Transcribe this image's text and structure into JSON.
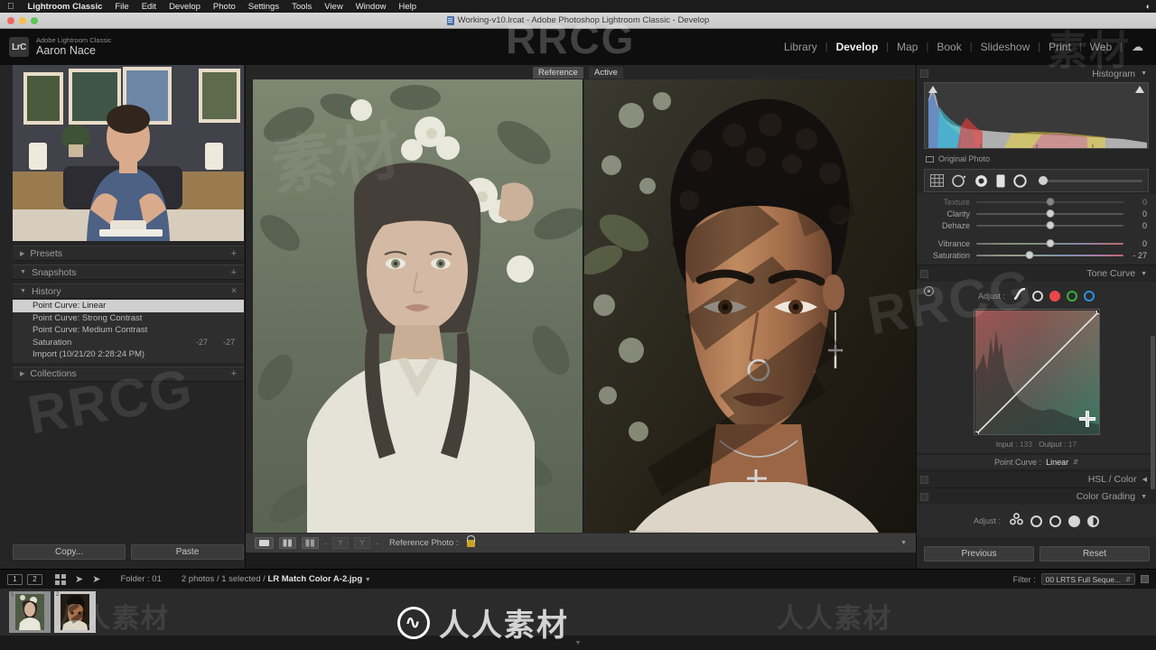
{
  "macmenu": {
    "apple_icon": "apple-icon",
    "items": [
      "Lightroom Classic",
      "File",
      "Edit",
      "Develop",
      "Photo",
      "Settings",
      "Tools",
      "View",
      "Window",
      "Help"
    ],
    "right_icons": [
      "siri-icon"
    ]
  },
  "window": {
    "title": "Working-v10.lrcat - Adobe Photoshop Lightroom Classic - Develop",
    "doc_icon": "catalog-file-icon",
    "traffic_lights": [
      "close",
      "minimize",
      "zoom"
    ]
  },
  "identity": {
    "logo": "LrC",
    "product": "Adobe Lightroom Classic",
    "user": "Aaron Nace"
  },
  "modules": {
    "items": [
      {
        "label": "Library",
        "active": false
      },
      {
        "label": "Develop",
        "active": true
      },
      {
        "label": "Map",
        "active": false
      },
      {
        "label": "Book",
        "active": false
      },
      {
        "label": "Slideshow",
        "active": false
      },
      {
        "label": "Print",
        "active": false
      },
      {
        "label": "Web",
        "active": false
      }
    ],
    "separator": "|",
    "cloud_icon": "cloud-icon"
  },
  "left_panel": {
    "navigator_alt": "video instructor preview",
    "sections": [
      {
        "name": "presets",
        "label": "Presets",
        "expanded": false,
        "action": "+"
      },
      {
        "name": "snapshots",
        "label": "Snapshots",
        "expanded": true,
        "action": "+"
      },
      {
        "name": "history",
        "label": "History",
        "expanded": true,
        "action": "×"
      },
      {
        "name": "collections",
        "label": "Collections",
        "expanded": false,
        "action": "+"
      }
    ],
    "history": [
      {
        "label": "Point Curve: Linear",
        "v1": "",
        "v2": "",
        "selected": true
      },
      {
        "label": "Point Curve: Strong Contrast",
        "v1": "",
        "v2": "",
        "selected": false
      },
      {
        "label": "Point Curve: Medium Contrast",
        "v1": "",
        "v2": "",
        "selected": false
      },
      {
        "label": "Saturation",
        "v1": "-27",
        "v2": "-27",
        "selected": false
      },
      {
        "label": "Import (10/21/20 2:28:24 PM)",
        "v1": "",
        "v2": "",
        "selected": false
      }
    ],
    "copy_label": "Copy...",
    "paste_label": "Paste"
  },
  "center": {
    "reference_label": "Reference",
    "active_label": "Active",
    "toolbar": {
      "loupe_icon": "loupe-view-icon",
      "compare_icon": "reference-compare-icon",
      "split_icon": "reference-split-icon",
      "dash1": "-",
      "before_icon": "before-view-icon",
      "after_icon": "after-view-icon",
      "dash2": "-",
      "reference_photo_label": "Reference Photo :",
      "lock_icon": "lock-icon",
      "chevron_icon": "chevron-down-icon"
    }
  },
  "right_panel": {
    "histogram": {
      "title": "Histogram",
      "collapse_icon": "chevron-down-icon",
      "shadow_clip_icon": "shadow-clipping-icon",
      "highlight_clip_icon": "highlight-clipping-icon",
      "original_photo_label": "Original Photo"
    },
    "tools": [
      "crop-tool-icon",
      "spot-removal-icon",
      "red-eye-icon",
      "graduated-filter-icon",
      "radial-filter-icon",
      "adjustment-brush-icon"
    ],
    "basic_sliders": [
      {
        "label": "Texture",
        "value": "0",
        "pos": 50,
        "style": "plain",
        "clipped": true
      },
      {
        "label": "Clarity",
        "value": "0",
        "pos": 50,
        "style": "plain",
        "clipped": false
      },
      {
        "label": "Dehaze",
        "value": "0",
        "pos": 50,
        "style": "plain",
        "clipped": false
      },
      {
        "label": "Vibrance",
        "value": "0",
        "pos": 50,
        "style": "vib",
        "clipped": false
      },
      {
        "label": "Saturation",
        "value": "- 27",
        "pos": 36,
        "style": "sat",
        "clipped": false
      }
    ],
    "tone_curve": {
      "title": "Tone Curve",
      "collapse_icon": "chevron-down-icon",
      "target_icon": "target-adjustment-icon",
      "adjust_label": "Adjust :",
      "channels": [
        "parametric-curve-icon",
        "point-curve-icon",
        "red-channel-icon",
        "green-channel-icon",
        "blue-channel-icon"
      ],
      "input_label": "Input :",
      "input_value": "133",
      "output_label": "Output :",
      "output_value": "17",
      "point_curve_label": "Point Curve :",
      "point_curve_value": "Linear",
      "point_curve_chevron": "chevron-updown-icon"
    },
    "hsl": {
      "title": "HSL / Color",
      "collapse_icon": "chevron-left-icon"
    },
    "color_grading": {
      "title": "Color Grading",
      "collapse_icon": "chevron-down-icon",
      "adjust_label": "Adjust :",
      "modes": [
        "3-way-grading-icon",
        "shadows-wheel-icon",
        "midtones-wheel-icon",
        "highlights-wheel-icon",
        "global-wheel-icon"
      ]
    },
    "previous_label": "Previous",
    "reset_label": "Reset"
  },
  "filmstrip_bar": {
    "display_1": "1",
    "display_2": "2",
    "grid_icon": "grid-view-icon",
    "back_icon": "arrow-left-icon",
    "forward_icon": "arrow-right-icon",
    "folder_label": "Folder : 01",
    "selection_info": "2 photos / 1 selected / ",
    "selected_file": "LR Match Color A-2.jpg",
    "file_chevron": "chevron-down-icon",
    "filter_label": "Filter :",
    "filter_value": "00 LRTS Full Seque...",
    "filter_chevron": "chevron-updown-icon",
    "filter_toggle_icon": "filter-toggle-icon"
  },
  "filmstrip": {
    "thumbs": [
      {
        "num": "1",
        "selected": false,
        "alt": "woman among white flowers"
      },
      {
        "num": "2",
        "selected": true,
        "alt": "man in dappled shade"
      }
    ],
    "footer_chevron": "chevron-down-icon"
  },
  "watermarks": {
    "top": "RRCG",
    "bottom": "人人素材",
    "side": "人人素材",
    "mark": "素材"
  },
  "colors": {
    "panel_bg": "#252525",
    "app_bg": "#1c1c1c",
    "canvas_bg": "#262626",
    "accent_text": "#f2f2f2",
    "lock_gold": "#c9a227",
    "red_channel": "#e8484a",
    "green_channel": "#35b23c",
    "blue_channel": "#2f8fe0"
  }
}
